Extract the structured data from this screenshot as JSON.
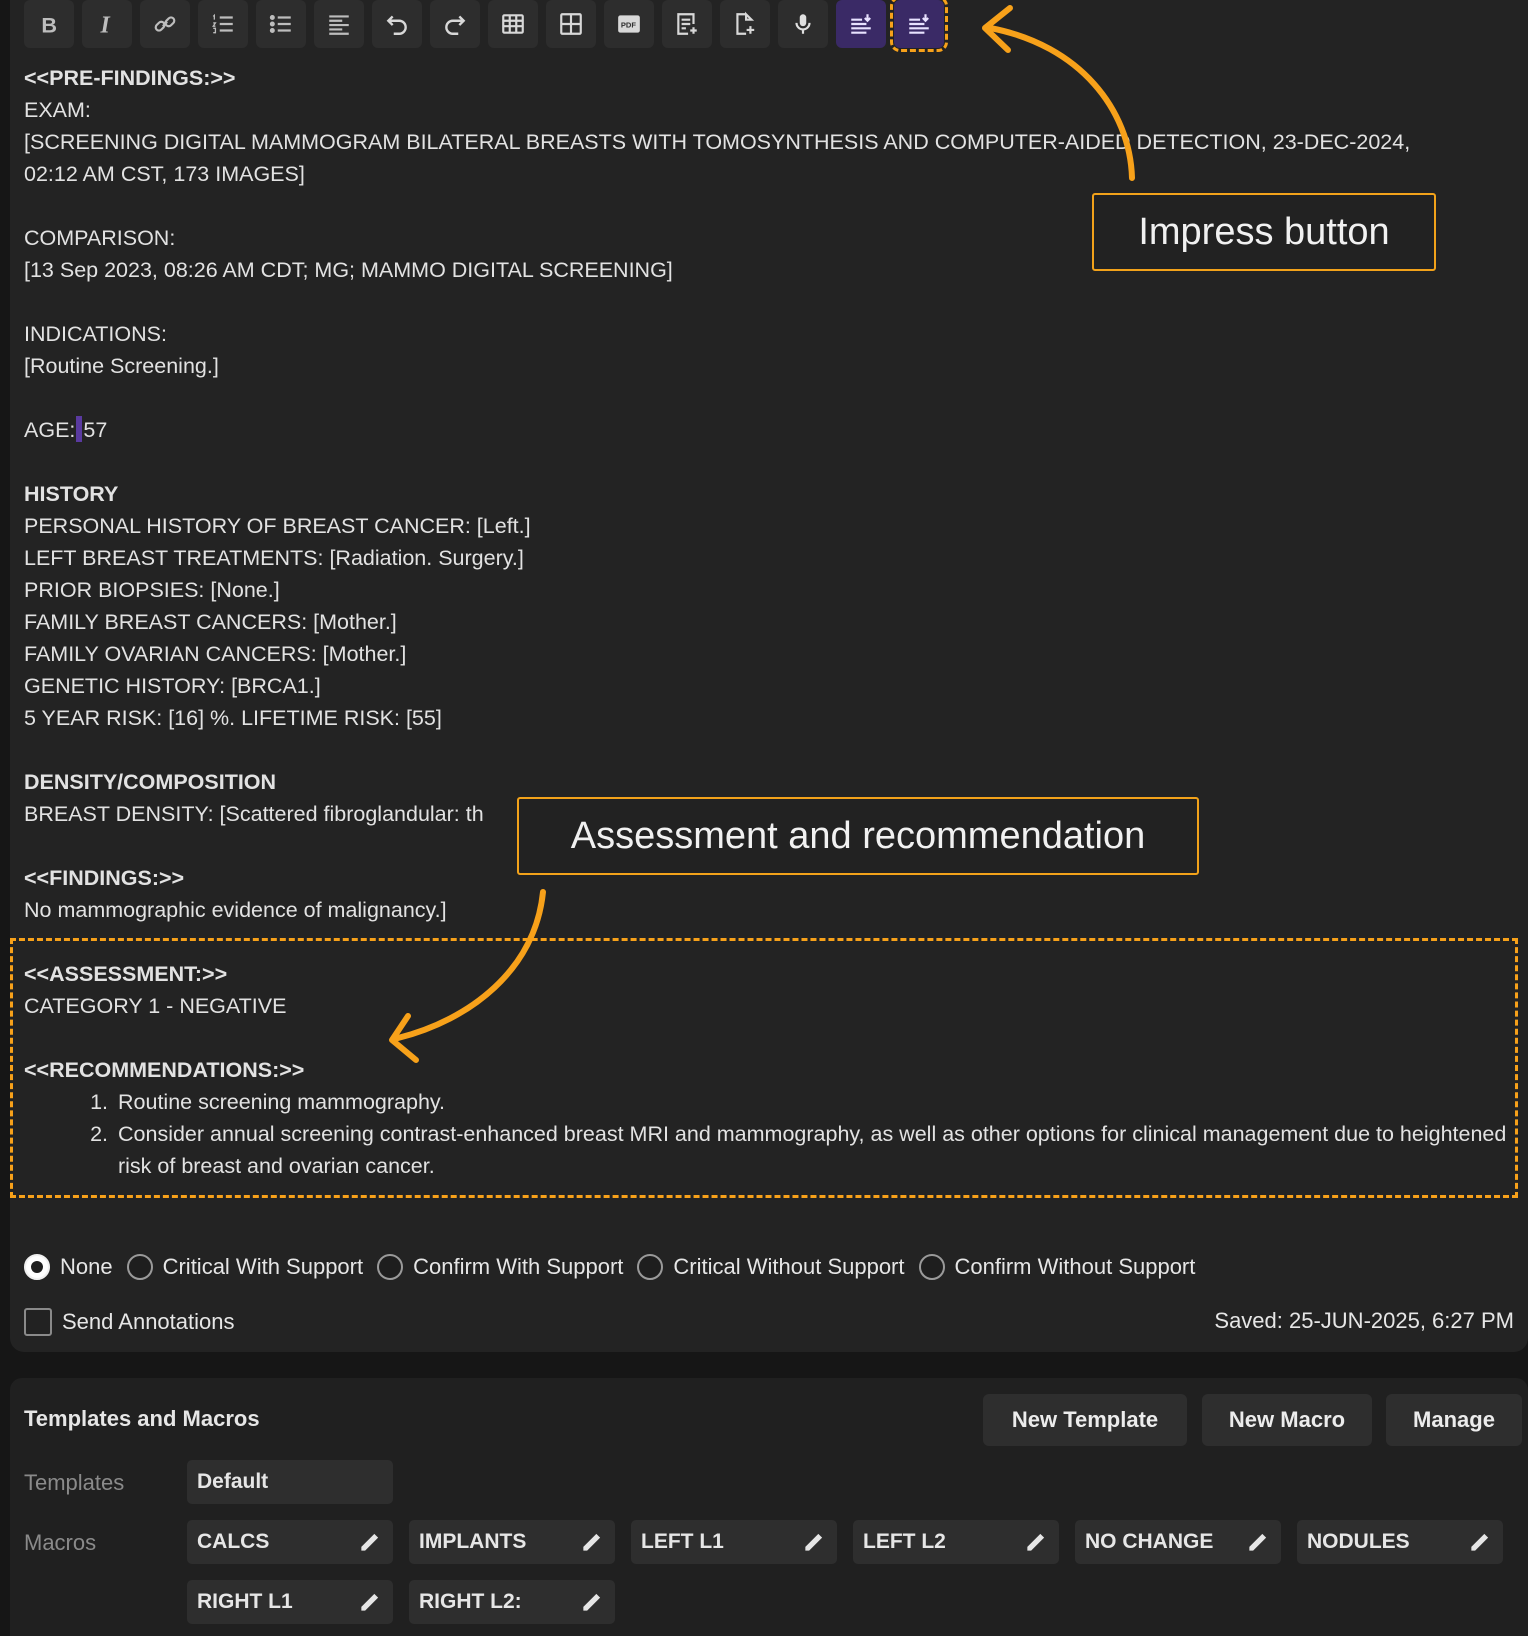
{
  "toolbar": {
    "buttons": [
      {
        "name": "bold-button",
        "icon": "bold-icon"
      },
      {
        "name": "italic-button",
        "icon": "italic-icon"
      },
      {
        "name": "link-button",
        "icon": "link-icon"
      },
      {
        "name": "numbered-list-button",
        "icon": "numbered-list-icon"
      },
      {
        "name": "bullet-list-button",
        "icon": "bullet-list-icon"
      },
      {
        "name": "align-left-button",
        "icon": "align-left-icon"
      },
      {
        "name": "undo-button",
        "icon": "undo-icon"
      },
      {
        "name": "redo-button",
        "icon": "redo-icon"
      },
      {
        "name": "insert-table-button",
        "icon": "table-icon"
      },
      {
        "name": "table-layout-button",
        "icon": "grid-icon"
      },
      {
        "name": "pdf-button",
        "icon": "pdf-icon",
        "label": "PDF"
      },
      {
        "name": "insert-note-button",
        "icon": "note-add-icon"
      },
      {
        "name": "add-document-button",
        "icon": "document-add-icon"
      },
      {
        "name": "dictate-button",
        "icon": "microphone-icon"
      },
      {
        "name": "ai-report-button",
        "icon": "ai-list-icon"
      },
      {
        "name": "impress-button",
        "icon": "ai-list-icon"
      }
    ]
  },
  "report": {
    "prefindings_header": "<<PRE-FINDINGS:>>",
    "exam_label": "EXAM:",
    "exam_line1": "[SCREENING DIGITAL MAMMOGRAM BILATERAL BREASTS WITH TOMOSYNTHESIS AND COMPUTER-AIDED DETECTION, 23-DEC-2024,",
    "exam_line2": "02:12 AM CST, 173 IMAGES]",
    "comparison_label": "COMPARISON:",
    "comparison_value": "[13 Sep 2023, 08:26 AM CDT; MG; MAMMO DIGITAL SCREENING]",
    "indications_label": "INDICATIONS:",
    "indications_value": "[Routine Screening.]",
    "age_label": "AGE:",
    "age_value": "57",
    "history_header": "HISTORY",
    "history_lines": [
      "PERSONAL HISTORY OF BREAST CANCER: [Left.]",
      "LEFT BREAST TREATMENTS: [Radiation. Surgery.]",
      "PRIOR BIOPSIES: [None.]",
      "FAMILY BREAST CANCERS: [Mother.]",
      "FAMILY OVARIAN CANCERS: [Mother.]",
      "GENETIC HISTORY: [BRCA1.]",
      "5 YEAR RISK: [16] %. LIFETIME RISK: [55]"
    ],
    "density_header": "DENSITY/COMPOSITION",
    "density_value": "BREAST DENSITY: [Scattered fibroglandular: th",
    "findings_header": "<<FINDINGS:>>",
    "findings_value": "No mammographic evidence of malignancy.]",
    "assessment_header": "<<ASSESSMENT:>>",
    "assessment_value": "CATEGORY 1 - NEGATIVE",
    "recommendations_header": "<<RECOMMENDATIONS:>>",
    "recommendations": [
      "Routine screening mammography.",
      "Consider annual screening contrast-enhanced breast MRI and mammography, as well as other options for clinical management due to heightened risk of breast and ovarian cancer."
    ]
  },
  "callouts": {
    "impress": "Impress button",
    "assessment": "Assessment and recommendation"
  },
  "notification": {
    "options": [
      "None",
      "Critical With Support",
      "Confirm With Support",
      "Critical Without Support",
      "Confirm Without Support"
    ],
    "selected": "None"
  },
  "send_annotations_label": "Send Annotations",
  "saved_text": "Saved: 25-JUN-2025, 6:27 PM",
  "templates_macros": {
    "title": "Templates and Macros",
    "new_template": "New Template",
    "new_macro": "New Macro",
    "manage": "Manage",
    "templates_label": "Templates",
    "template_value": "Default",
    "macros_label": "Macros",
    "macros": [
      "CALCS",
      "IMPLANTS",
      "LEFT L1",
      "LEFT L2",
      "NO CHANGE",
      "NODULES",
      "RIGHT L1",
      "RIGHT L2:"
    ]
  },
  "colors": {
    "accent_orange": "#f7a11a",
    "ai_button_purple": "#3a2a66",
    "background": "#232323"
  }
}
